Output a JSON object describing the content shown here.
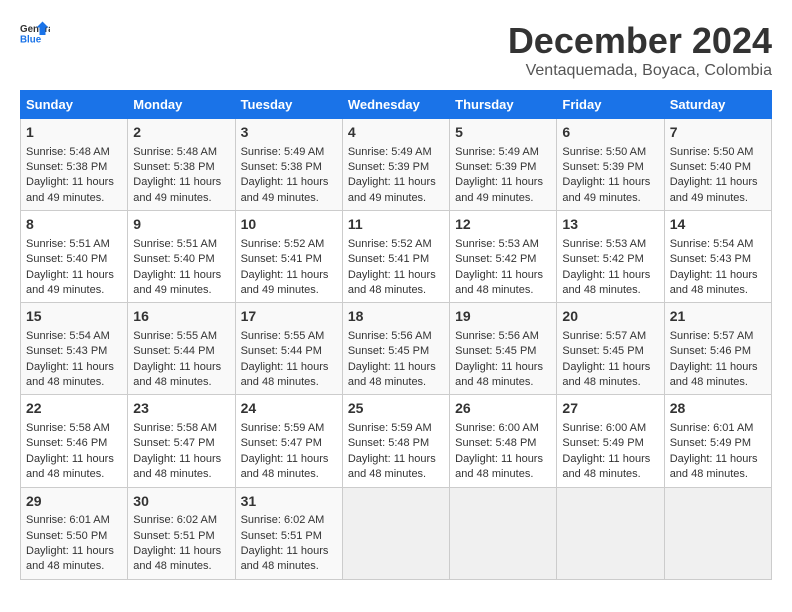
{
  "logo": {
    "line1": "General",
    "line2": "Blue"
  },
  "title": "December 2024",
  "subtitle": "Ventaquemada, Boyaca, Colombia",
  "days_header": [
    "Sunday",
    "Monday",
    "Tuesday",
    "Wednesday",
    "Thursday",
    "Friday",
    "Saturday"
  ],
  "weeks": [
    [
      {
        "day": "1",
        "sunrise": "5:48 AM",
        "sunset": "5:38 PM",
        "daylight": "11 hours and 49 minutes."
      },
      {
        "day": "2",
        "sunrise": "5:48 AM",
        "sunset": "5:38 PM",
        "daylight": "11 hours and 49 minutes."
      },
      {
        "day": "3",
        "sunrise": "5:49 AM",
        "sunset": "5:38 PM",
        "daylight": "11 hours and 49 minutes."
      },
      {
        "day": "4",
        "sunrise": "5:49 AM",
        "sunset": "5:39 PM",
        "daylight": "11 hours and 49 minutes."
      },
      {
        "day": "5",
        "sunrise": "5:49 AM",
        "sunset": "5:39 PM",
        "daylight": "11 hours and 49 minutes."
      },
      {
        "day": "6",
        "sunrise": "5:50 AM",
        "sunset": "5:39 PM",
        "daylight": "11 hours and 49 minutes."
      },
      {
        "day": "7",
        "sunrise": "5:50 AM",
        "sunset": "5:40 PM",
        "daylight": "11 hours and 49 minutes."
      }
    ],
    [
      {
        "day": "8",
        "sunrise": "5:51 AM",
        "sunset": "5:40 PM",
        "daylight": "11 hours and 49 minutes."
      },
      {
        "day": "9",
        "sunrise": "5:51 AM",
        "sunset": "5:40 PM",
        "daylight": "11 hours and 49 minutes."
      },
      {
        "day": "10",
        "sunrise": "5:52 AM",
        "sunset": "5:41 PM",
        "daylight": "11 hours and 49 minutes."
      },
      {
        "day": "11",
        "sunrise": "5:52 AM",
        "sunset": "5:41 PM",
        "daylight": "11 hours and 48 minutes."
      },
      {
        "day": "12",
        "sunrise": "5:53 AM",
        "sunset": "5:42 PM",
        "daylight": "11 hours and 48 minutes."
      },
      {
        "day": "13",
        "sunrise": "5:53 AM",
        "sunset": "5:42 PM",
        "daylight": "11 hours and 48 minutes."
      },
      {
        "day": "14",
        "sunrise": "5:54 AM",
        "sunset": "5:43 PM",
        "daylight": "11 hours and 48 minutes."
      }
    ],
    [
      {
        "day": "15",
        "sunrise": "5:54 AM",
        "sunset": "5:43 PM",
        "daylight": "11 hours and 48 minutes."
      },
      {
        "day": "16",
        "sunrise": "5:55 AM",
        "sunset": "5:44 PM",
        "daylight": "11 hours and 48 minutes."
      },
      {
        "day": "17",
        "sunrise": "5:55 AM",
        "sunset": "5:44 PM",
        "daylight": "11 hours and 48 minutes."
      },
      {
        "day": "18",
        "sunrise": "5:56 AM",
        "sunset": "5:45 PM",
        "daylight": "11 hours and 48 minutes."
      },
      {
        "day": "19",
        "sunrise": "5:56 AM",
        "sunset": "5:45 PM",
        "daylight": "11 hours and 48 minutes."
      },
      {
        "day": "20",
        "sunrise": "5:57 AM",
        "sunset": "5:45 PM",
        "daylight": "11 hours and 48 minutes."
      },
      {
        "day": "21",
        "sunrise": "5:57 AM",
        "sunset": "5:46 PM",
        "daylight": "11 hours and 48 minutes."
      }
    ],
    [
      {
        "day": "22",
        "sunrise": "5:58 AM",
        "sunset": "5:46 PM",
        "daylight": "11 hours and 48 minutes."
      },
      {
        "day": "23",
        "sunrise": "5:58 AM",
        "sunset": "5:47 PM",
        "daylight": "11 hours and 48 minutes."
      },
      {
        "day": "24",
        "sunrise": "5:59 AM",
        "sunset": "5:47 PM",
        "daylight": "11 hours and 48 minutes."
      },
      {
        "day": "25",
        "sunrise": "5:59 AM",
        "sunset": "5:48 PM",
        "daylight": "11 hours and 48 minutes."
      },
      {
        "day": "26",
        "sunrise": "6:00 AM",
        "sunset": "5:48 PM",
        "daylight": "11 hours and 48 minutes."
      },
      {
        "day": "27",
        "sunrise": "6:00 AM",
        "sunset": "5:49 PM",
        "daylight": "11 hours and 48 minutes."
      },
      {
        "day": "28",
        "sunrise": "6:01 AM",
        "sunset": "5:49 PM",
        "daylight": "11 hours and 48 minutes."
      }
    ],
    [
      {
        "day": "29",
        "sunrise": "6:01 AM",
        "sunset": "5:50 PM",
        "daylight": "11 hours and 48 minutes."
      },
      {
        "day": "30",
        "sunrise": "6:02 AM",
        "sunset": "5:51 PM",
        "daylight": "11 hours and 48 minutes."
      },
      {
        "day": "31",
        "sunrise": "6:02 AM",
        "sunset": "5:51 PM",
        "daylight": "11 hours and 48 minutes."
      },
      null,
      null,
      null,
      null
    ]
  ],
  "labels": {
    "sunrise": "Sunrise:",
    "sunset": "Sunset:",
    "daylight": "Daylight:"
  }
}
